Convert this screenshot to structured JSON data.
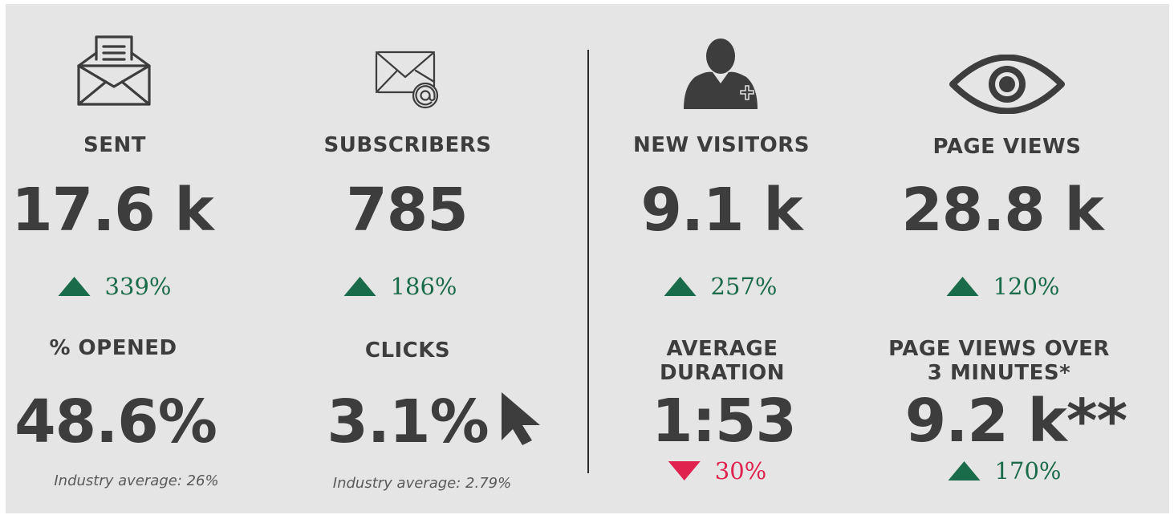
{
  "colors": {
    "up": "#1a6b4a",
    "down": "#e0234e",
    "text": "#3d3d3d",
    "background": "#e5e5e5"
  },
  "email": {
    "sent": {
      "icon": "open-envelope-icon",
      "label": "SENT",
      "value": "17.6 k",
      "change": "339%",
      "direction": "up"
    },
    "subscribers": {
      "icon": "envelope-at-icon",
      "label": "SUBSCRIBERS",
      "value": "785",
      "change": "186%",
      "direction": "up"
    },
    "opened": {
      "label": "% OPENED",
      "value": "48.6%",
      "note": "Industry average: 26%"
    },
    "clicks": {
      "icon": "cursor-arrow-icon",
      "label": "CLICKS",
      "value": "3.1%",
      "note": "Industry average: 2.79%"
    }
  },
  "web": {
    "new_visitors": {
      "icon": "add-user-icon",
      "label": "NEW VISITORS",
      "value": "9.1 k",
      "change": "257%",
      "direction": "up"
    },
    "page_views": {
      "icon": "eye-icon",
      "label": "PAGE VIEWS",
      "value": "28.8 k",
      "change": "120%",
      "direction": "up"
    },
    "avg_duration": {
      "label_line1": "AVERAGE",
      "label_line2": "DURATION",
      "value": "1:53",
      "change": "30%",
      "direction": "down"
    },
    "long_views": {
      "label_line1": "PAGE VIEWS OVER",
      "label_line2": "3 MINUTES*",
      "value": "9.2 k**",
      "change": "170%",
      "direction": "up"
    }
  }
}
